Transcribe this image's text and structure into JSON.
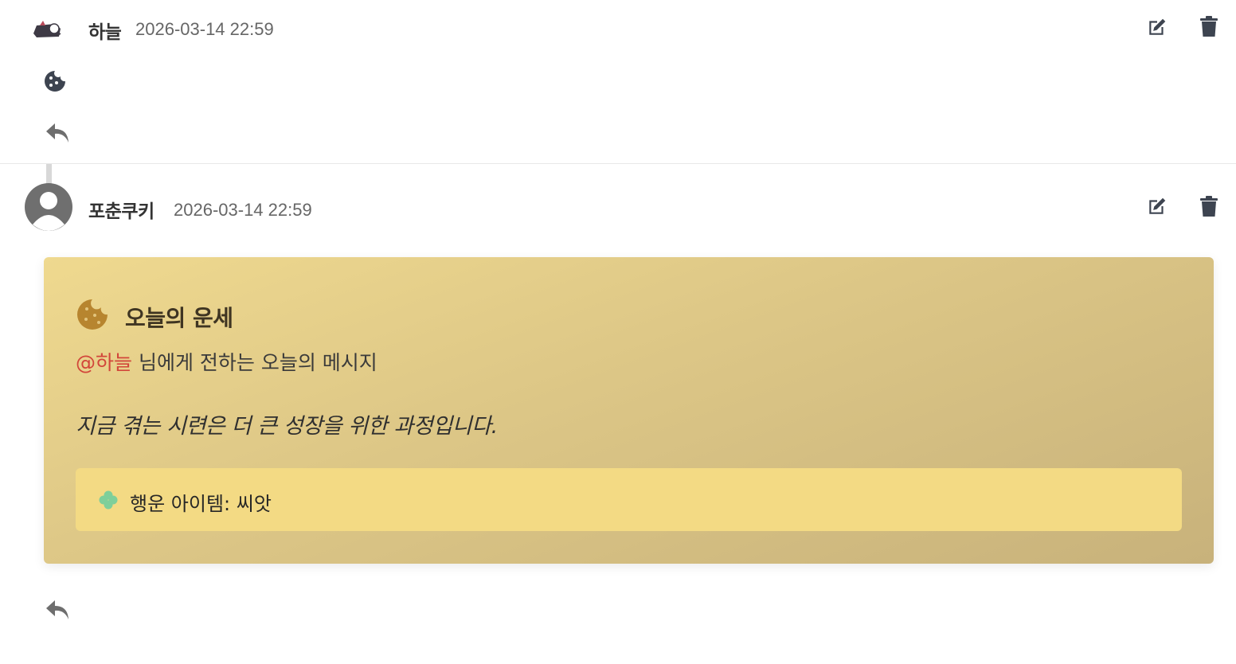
{
  "comments": [
    {
      "author": "하늘",
      "timestamp": "2026-03-14 22:59",
      "edit_icon": "edit-icon",
      "delete_icon": "trash-icon",
      "body_icon": "cookie-icon",
      "reply_icon": "reply-icon"
    },
    {
      "author": "포춘쿠키",
      "timestamp": "2026-03-14 22:59",
      "edit_icon": "edit-icon",
      "delete_icon": "trash-icon",
      "reply_icon": "reply-icon",
      "fortune": {
        "icon": "cookie-icon",
        "title": "오늘의 운세",
        "mention": "@하늘",
        "subtitle_suffix": "님에게 전하는 오늘의 메시지",
        "message": "지금 겪는 시련은 더 큰 성장을 위한 과정입니다.",
        "lucky_icon": "clover-icon",
        "lucky_item": "행운 아이템: 씨앗"
      }
    }
  ],
  "colors": {
    "icon": "#3d4450",
    "mention": "#d2463a",
    "card_gradient_start": "#efd98f",
    "card_gradient_end": "#c8b27b",
    "lucky_box": "#f3da84",
    "clover": "#7ecf9a"
  }
}
